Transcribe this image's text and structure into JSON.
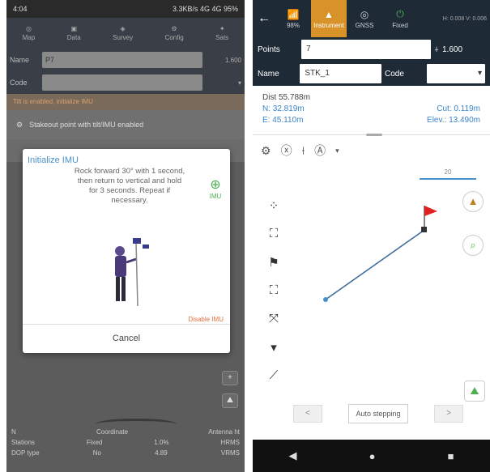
{
  "left": {
    "status_time": "4:04",
    "status_right": "3.3KB/s 4G 4G 95%",
    "toolbar": [
      "Map",
      "Data",
      "Survey",
      "Config",
      "Sats"
    ],
    "name_label": "Name",
    "name_value": "P7",
    "code_label": "Code",
    "warning": "Tilt is enabled, initialize IMU",
    "bluetooth_text": "Stakeout point with tilt/IMU enabled",
    "dialog": {
      "title": "Initialize IMU",
      "text": "Rock forward 30° with 1 second, then return to vertical and hold for 3 seconds. Repeat if necessary.",
      "icon_caption": "IMU",
      "disable": "Disable IMU",
      "cancel": "Cancel"
    },
    "bottom_rows": [
      [
        "N",
        "Coordinate",
        "",
        "Antenna ht"
      ],
      [
        "Stations",
        "Fixed",
        "1.0%",
        "HRMS"
      ],
      [
        "DOP type",
        "No",
        "4.89",
        "VRMS"
      ]
    ]
  },
  "right": {
    "back_icon": "arrow-left-icon",
    "top_segments": [
      {
        "label": "98%",
        "icon": "antenna"
      },
      {
        "label": "Instrument",
        "icon": "cone",
        "active": true
      },
      {
        "label": "GNSS",
        "icon": "satellite"
      },
      {
        "label": "Fixed",
        "icon": "power"
      }
    ],
    "top_status": "H: 0.008\nV: 0.006",
    "points_label": "Points",
    "points_value": "7",
    "height_value": "1.600",
    "name_label": "Name",
    "name_value": "STK_1",
    "code_label": "Code",
    "dist": "Dist 55.788m",
    "north": "N: 32.819m",
    "east": "E: 45.110m",
    "cut": "Cut: 0.119m",
    "elev": "Elev.: 13.490m",
    "scale": "20",
    "auto_label": "Auto stepping",
    "prev": "<",
    "next": ">",
    "nav": [
      "◀",
      "●",
      "■"
    ]
  }
}
